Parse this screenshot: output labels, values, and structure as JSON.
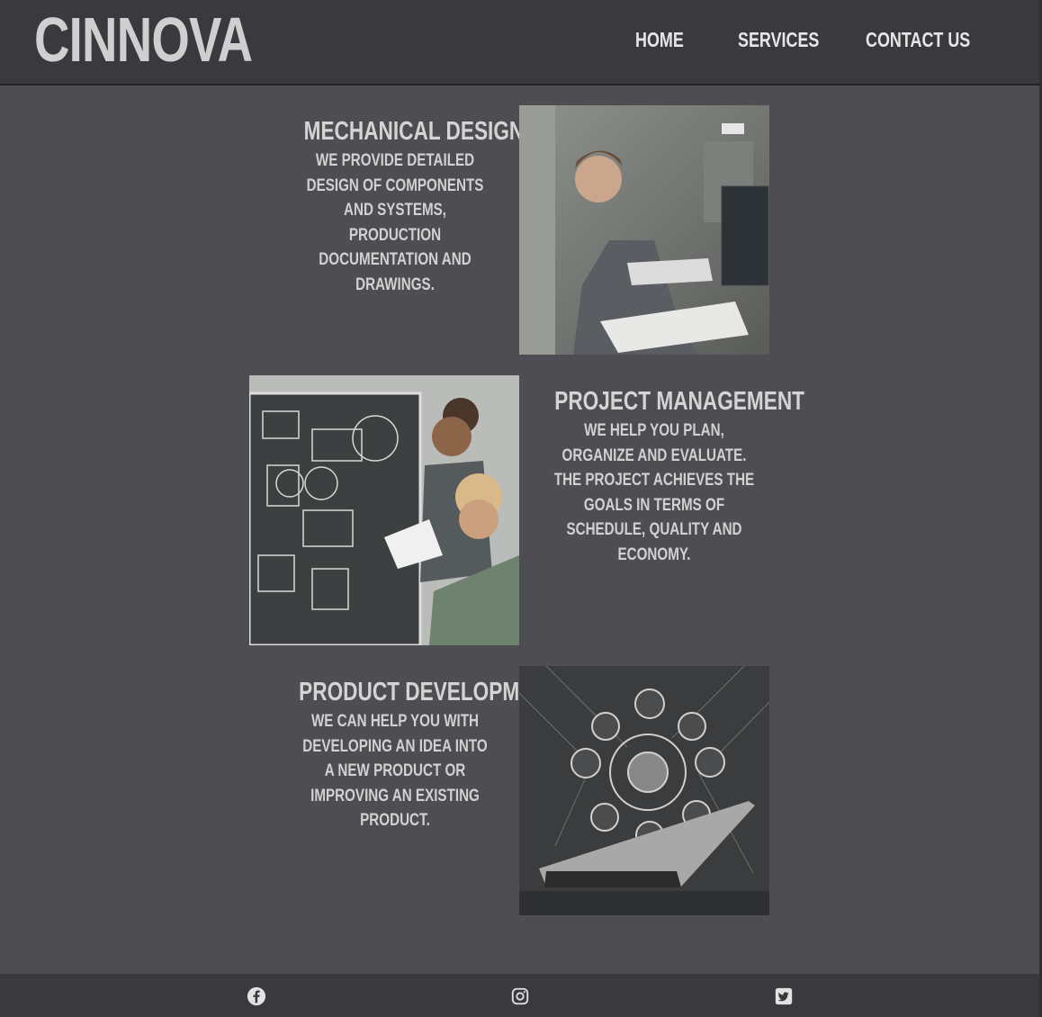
{
  "brand": {
    "logo": "CINNOVA"
  },
  "nav": {
    "home": "HOME",
    "services": "SERVICES",
    "contact": "CONTACT US"
  },
  "services": [
    {
      "title": "MECHANICAL DESIGN",
      "description": "WE PROVIDE DETAILED DESIGN OF COMPONENTS AND SYSTEMS, PRODUCTION DOCUMENTATION AND DRAWINGS.",
      "image": "engineer-at-drafting-desk-photo"
    },
    {
      "title": "PROJECT MANAGEMENT",
      "description": "WE HELP YOU PLAN, ORGANIZE AND EVALUATE. THE PROJECT ACHIEVES THE GOALS IN TERMS OF SCHEDULE, QUALITY AND ECONOMY.",
      "image": "team-at-whiteboard-photo"
    },
    {
      "title": "PRODUCT DEVELOPMENT",
      "description": "WE CAN HELP YOU WITH DEVELOPING AN IDEA INTO A NEW PRODUCT OR IMPROVING AN EXISTING PRODUCT.",
      "image": "laptop-with-gear-diagram-photo"
    }
  ],
  "footer": {
    "icons": [
      "facebook-icon",
      "instagram-icon",
      "twitter-icon"
    ]
  },
  "colors": {
    "background": "#4e4e52",
    "header": "#3a393e",
    "text": "#d4d4d4"
  }
}
